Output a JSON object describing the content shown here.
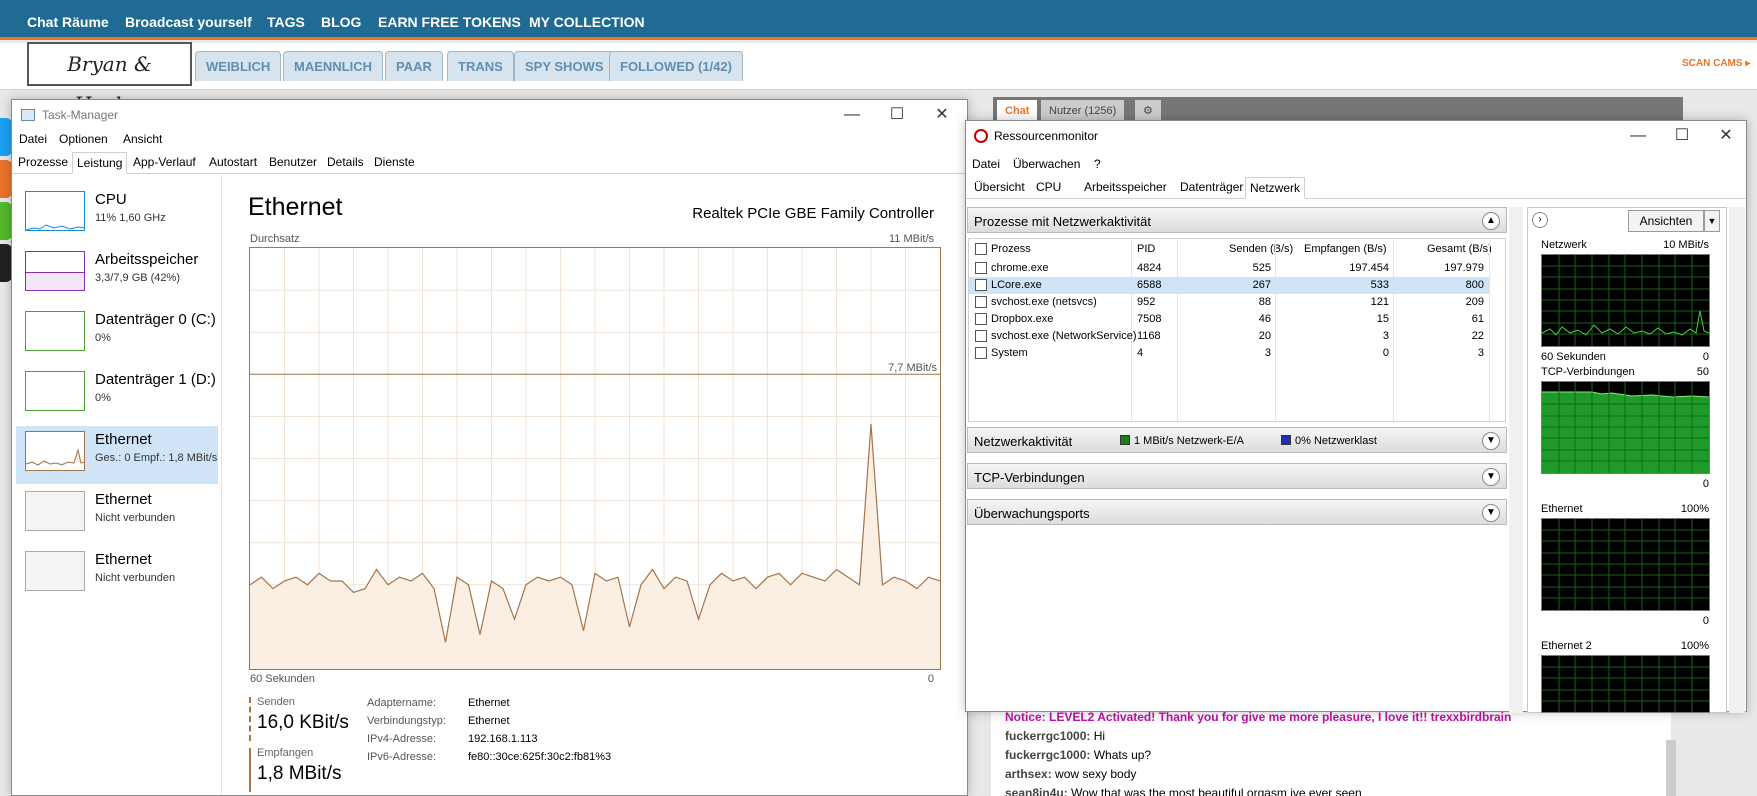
{
  "site": {
    "nav": [
      "Chat Räume",
      "Broadcast yourself",
      "TAGS",
      "BLOG",
      "EARN FREE TOKENS",
      "MY COLLECTION"
    ],
    "logo_text": "Bryan & Haylee",
    "tabs": [
      "WEIBLICH",
      "MAENNLICH",
      "PAAR",
      "TRANS",
      "SPY SHOWS",
      "FOLLOWED (1/42)"
    ],
    "scan_cams": "SCAN CAMS ▸",
    "chat_tab": "Chat",
    "users_tab": "Nutzer (1256)",
    "chat_lines": [
      {
        "user": "",
        "text": "Notice: LEVEL2 Activated! Thank you for give me more pleasure, I love it!! trexxbirdbrain",
        "notice": true
      },
      {
        "user": "fuckerrgc1000:",
        "text": "Hi"
      },
      {
        "user": "fuckerrgc1000:",
        "text": "Whats up?"
      },
      {
        "user": "arthsex:",
        "text": "wow sexy body"
      },
      {
        "user": "sean8in4u:",
        "text": "Wow that was the most beautiful orgasm ive ever seen"
      }
    ]
  },
  "taskmgr": {
    "title": "Task-Manager",
    "menu": [
      "Datei",
      "Optionen",
      "Ansicht"
    ],
    "tabs": [
      "Prozesse",
      "Leistung",
      "App-Verlauf",
      "Autostart",
      "Benutzer",
      "Details",
      "Dienste"
    ],
    "active_tab": "Leistung",
    "resources": [
      {
        "name": "CPU",
        "sub": "11% 1,60 GHz",
        "color": "#1a8bd6"
      },
      {
        "name": "Arbeitsspeicher",
        "sub": "3,3/7,9 GB (42%)",
        "color": "#8b2eb0"
      },
      {
        "name": "Datenträger 0 (C:)",
        "sub": "0%",
        "color": "#4aa02c"
      },
      {
        "name": "Datenträger 1 (D:)",
        "sub": "0%",
        "color": "#4aa02c"
      },
      {
        "name": "Ethernet",
        "sub": "Ges.: 0 Empf.: 1,8 MBit/s",
        "color": "#a5744a"
      },
      {
        "name": "Ethernet",
        "sub": "Nicht verbunden",
        "color": "#aaaaaa"
      },
      {
        "name": "Ethernet",
        "sub": "Nicht verbunden",
        "color": "#aaaaaa"
      }
    ],
    "heading": "Ethernet",
    "adapter": "Realtek PCIe GBE Family Controller",
    "graph_label": "Durchsatz",
    "graph_max": "11 MBit/s",
    "graph_mid": "7,7 MBit/s",
    "axis_left": "60 Sekunden",
    "axis_right": "0",
    "graph_values": [
      2.2,
      2.4,
      2.1,
      2.3,
      2.4,
      2.2,
      2.5,
      2.3,
      2.3,
      2.0,
      2.1,
      2.6,
      2.2,
      2.4,
      2.3,
      2.5,
      2.1,
      0.7,
      2.4,
      2.2,
      0.9,
      2.3,
      2.1,
      1.3,
      2.2,
      2.4,
      2.3,
      2.4,
      2.2,
      1.0,
      2.5,
      2.3,
      2.4,
      1.1,
      2.2,
      2.6,
      2.1,
      2.4,
      2.3,
      1.3,
      2.2,
      2.5,
      2.3,
      2.4,
      2.1,
      2.4,
      2.5,
      2.2,
      2.5,
      2.4,
      2.3,
      2.6,
      2.4,
      2.2,
      6.4,
      2.2,
      2.4,
      2.3,
      2.1,
      2.4,
      2.3
    ],
    "send_label": "Senden",
    "send_value": "16,0 KBit/s",
    "recv_label": "Empfangen",
    "recv_value": "1,8 MBit/s",
    "info": [
      {
        "key": "Adaptername:",
        "val": "Ethernet"
      },
      {
        "key": "Verbindungstyp:",
        "val": "Ethernet"
      },
      {
        "key": "IPv4-Adresse:",
        "val": "192.168.1.113"
      },
      {
        "key": "IPv6-Adresse:",
        "val": "fe80::30ce:625f:30c2:fb81%3"
      }
    ]
  },
  "resmon": {
    "title": "Ressourcenmonitor",
    "menu": [
      "Datei",
      "Überwachen",
      "?"
    ],
    "tabs": [
      "Übersicht",
      "CPU",
      "Arbeitsspeicher",
      "Datenträger",
      "Netzwerk"
    ],
    "active_tab": "Netzwerk",
    "section_procs": "Prozesse mit Netzwerkaktivität",
    "columns": [
      "Prozess",
      "PID",
      "Senden (B/s)",
      "Empfangen (B/s)",
      "Gesamt (B/s)"
    ],
    "processes": [
      {
        "name": "chrome.exe",
        "pid": "4824",
        "send": "525",
        "recv": "197.454",
        "total": "197.979"
      },
      {
        "name": "LCore.exe",
        "pid": "6588",
        "send": "267",
        "recv": "533",
        "total": "800"
      },
      {
        "name": "svchost.exe (netsvcs)",
        "pid": "952",
        "send": "88",
        "recv": "121",
        "total": "209"
      },
      {
        "name": "Dropbox.exe",
        "pid": "7508",
        "send": "46",
        "recv": "15",
        "total": "61"
      },
      {
        "name": "svchost.exe (NetworkService)",
        "pid": "1168",
        "send": "20",
        "recv": "3",
        "total": "22"
      },
      {
        "name": "System",
        "pid": "4",
        "send": "3",
        "recv": "0",
        "total": "3"
      }
    ],
    "section_activity": "Netzwerkaktivität",
    "activity_io": "1 MBit/s Netzwerk-E/A",
    "activity_load": "0% Netzwerklast",
    "section_tcp": "TCP-Verbindungen",
    "section_ports": "Überwachungsports",
    "views_button": "Ansichten",
    "graphs": [
      {
        "name": "Netzwerk",
        "max": "10 MBit/s",
        "min_left": "60 Sekunden",
        "min_right": "0"
      },
      {
        "name": "TCP-Verbindungen",
        "max": "50",
        "min_right": "0"
      },
      {
        "name": "Ethernet",
        "max": "100%",
        "min_right": "0"
      },
      {
        "name": "Ethernet 2",
        "max": "100%"
      }
    ]
  }
}
